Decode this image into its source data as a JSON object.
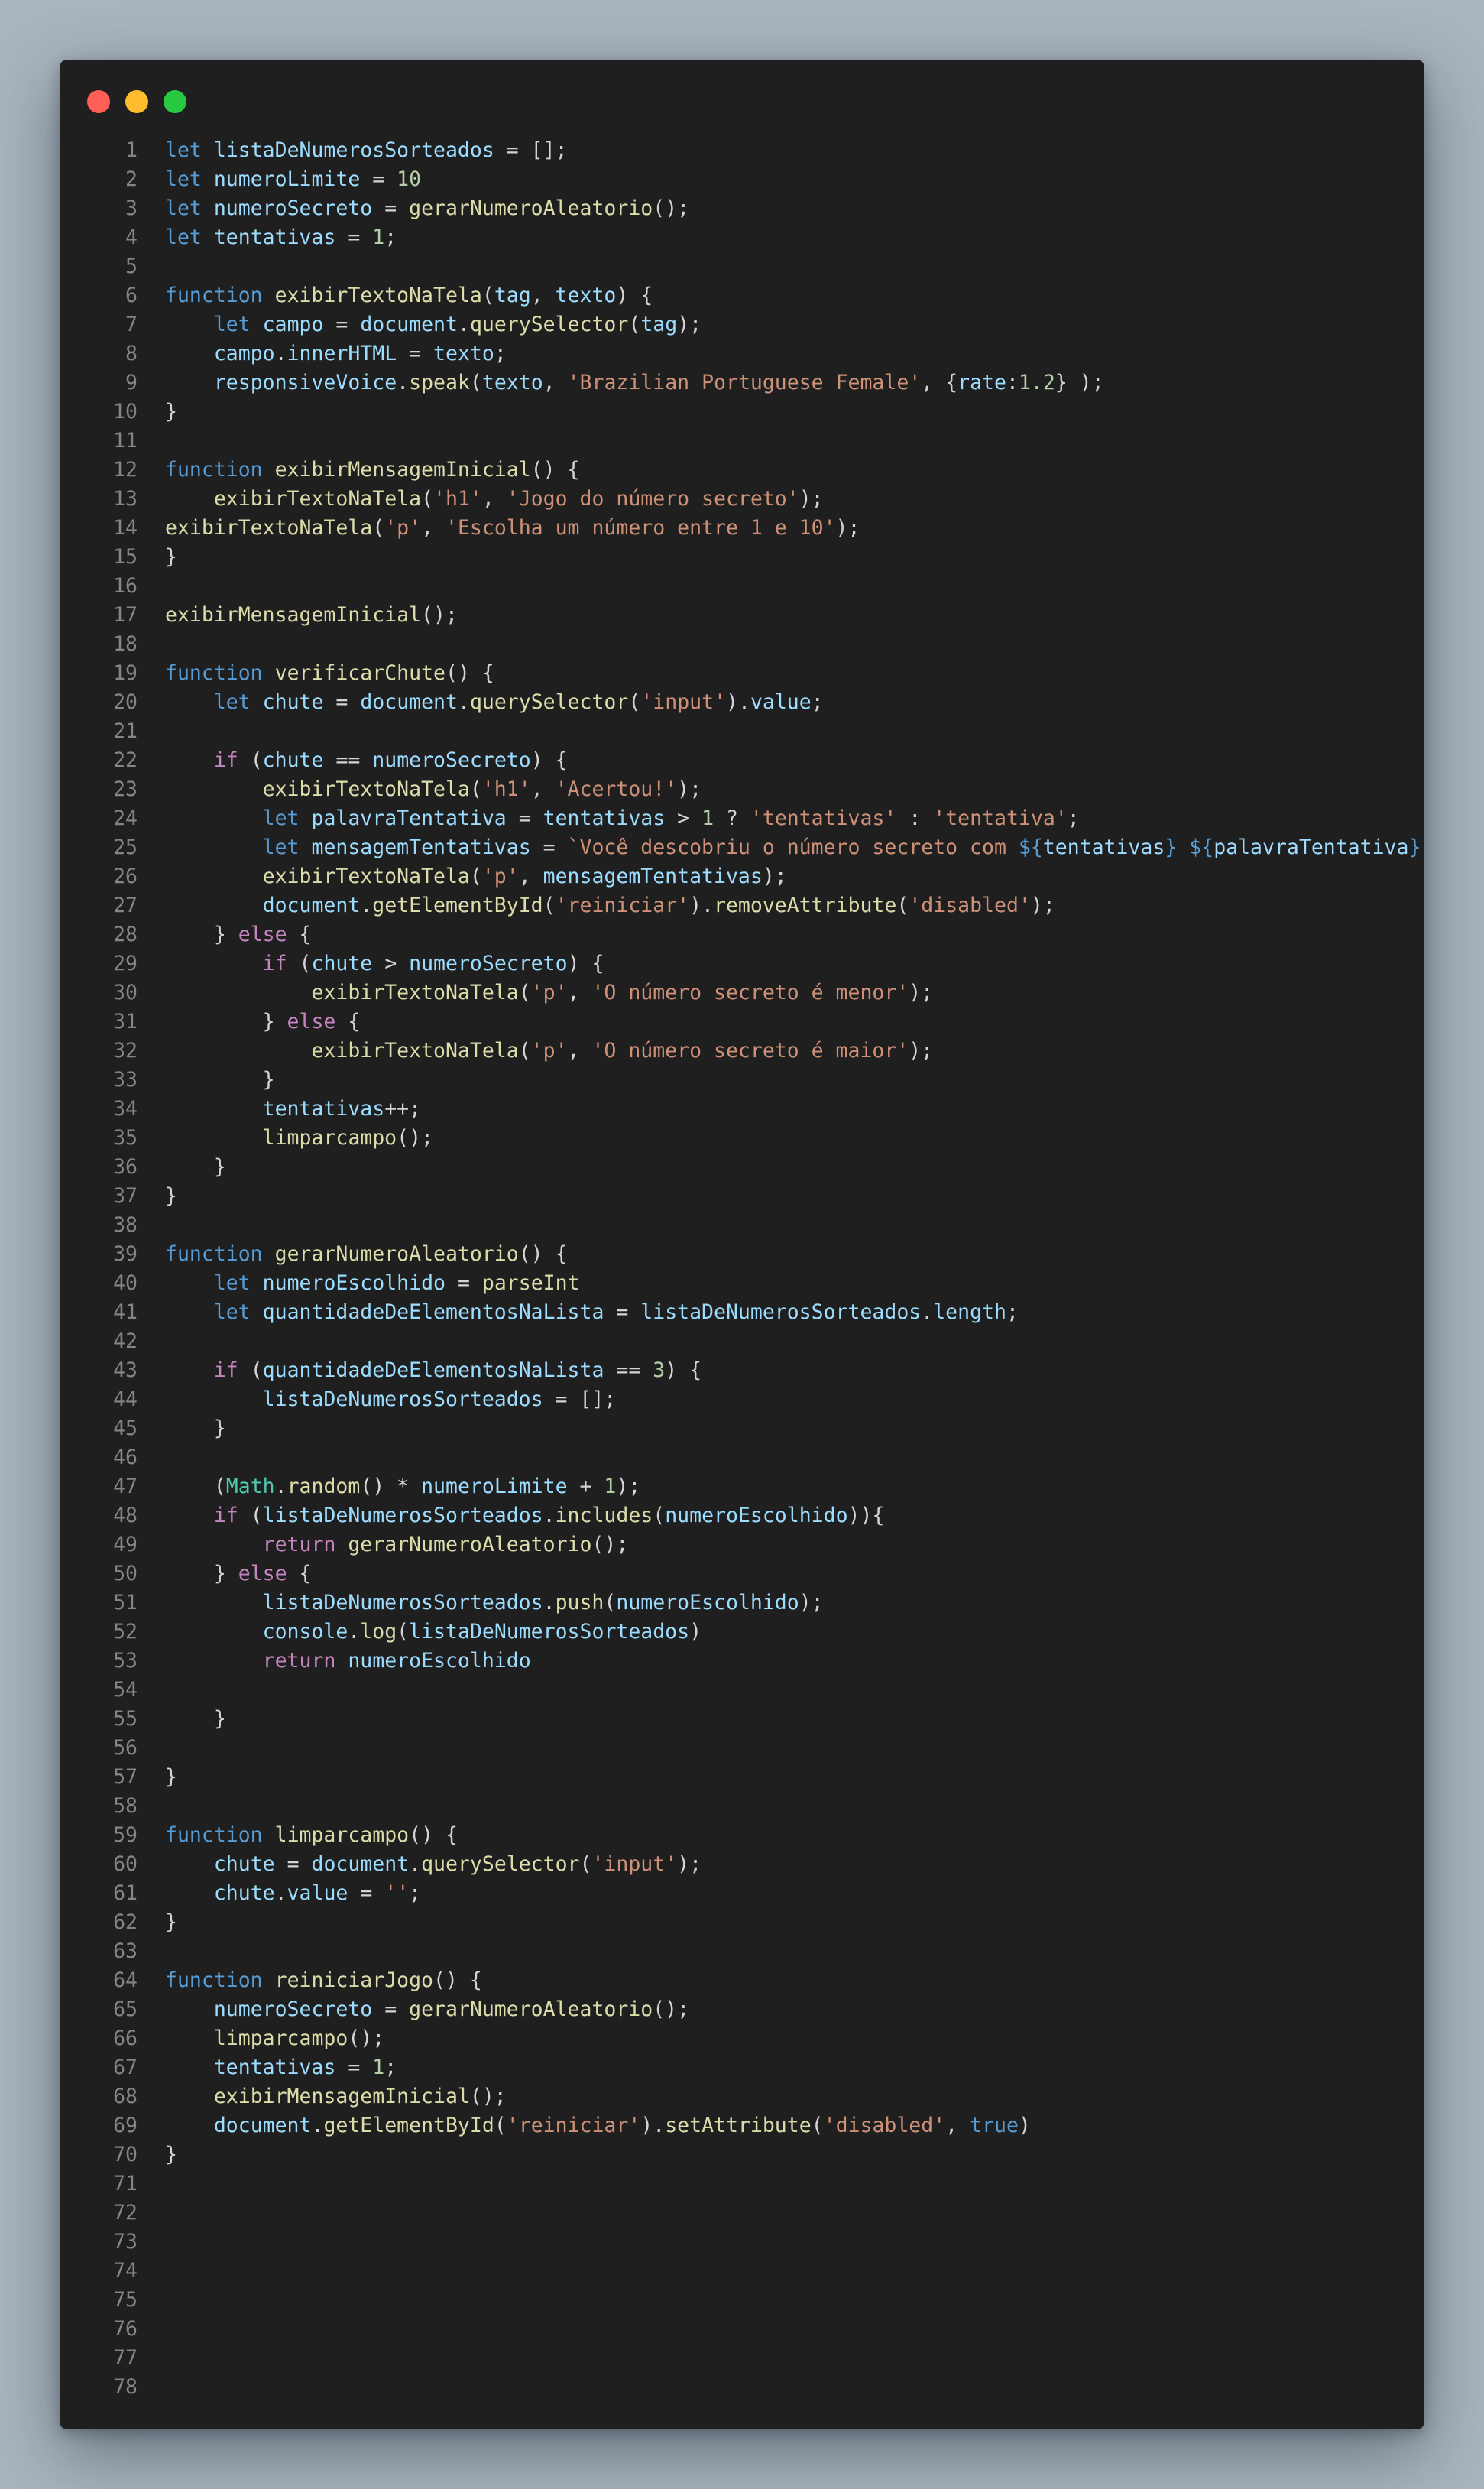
{
  "window": {
    "controls": [
      {
        "name": "close",
        "color": "#ff5f57"
      },
      {
        "name": "minimize",
        "color": "#febc2e"
      },
      {
        "name": "maximize",
        "color": "#28c840"
      }
    ]
  },
  "code": {
    "language": "javascript",
    "lines": [
      [
        [
          "k",
          "let"
        ],
        [
          "t",
          " "
        ],
        [
          "v",
          "listaDeNumerosSorteados"
        ],
        [
          "t",
          " = [];"
        ]
      ],
      [
        [
          "k",
          "let"
        ],
        [
          "t",
          " "
        ],
        [
          "v",
          "numeroLimite"
        ],
        [
          "t",
          " = "
        ],
        [
          "n",
          "10"
        ]
      ],
      [
        [
          "k",
          "let"
        ],
        [
          "t",
          " "
        ],
        [
          "v",
          "numeroSecreto"
        ],
        [
          "t",
          " = "
        ],
        [
          "f",
          "gerarNumeroAleatorio"
        ],
        [
          "t",
          "();"
        ]
      ],
      [
        [
          "k",
          "let"
        ],
        [
          "t",
          " "
        ],
        [
          "v",
          "tentativas"
        ],
        [
          "t",
          " = "
        ],
        [
          "n",
          "1"
        ],
        [
          "t",
          ";"
        ]
      ],
      [],
      [
        [
          "k",
          "function"
        ],
        [
          "t",
          " "
        ],
        [
          "f",
          "exibirTextoNaTela"
        ],
        [
          "t",
          "("
        ],
        [
          "v",
          "tag"
        ],
        [
          "t",
          ", "
        ],
        [
          "v",
          "texto"
        ],
        [
          "t",
          ") {"
        ]
      ],
      [
        [
          "t",
          "    "
        ],
        [
          "k",
          "let"
        ],
        [
          "t",
          " "
        ],
        [
          "v",
          "campo"
        ],
        [
          "t",
          " = "
        ],
        [
          "v",
          "document"
        ],
        [
          "t",
          "."
        ],
        [
          "f",
          "querySelector"
        ],
        [
          "t",
          "("
        ],
        [
          "v",
          "tag"
        ],
        [
          "t",
          ");"
        ]
      ],
      [
        [
          "t",
          "    "
        ],
        [
          "v",
          "campo"
        ],
        [
          "t",
          "."
        ],
        [
          "v",
          "innerHTML"
        ],
        [
          "t",
          " = "
        ],
        [
          "v",
          "texto"
        ],
        [
          "t",
          ";"
        ]
      ],
      [
        [
          "t",
          "    "
        ],
        [
          "v",
          "responsiveVoice"
        ],
        [
          "t",
          "."
        ],
        [
          "f",
          "speak"
        ],
        [
          "t",
          "("
        ],
        [
          "v",
          "texto"
        ],
        [
          "t",
          ", "
        ],
        [
          "s",
          "'Brazilian Portuguese Female'"
        ],
        [
          "t",
          ", {"
        ],
        [
          "v",
          "rate"
        ],
        [
          "t",
          ":"
        ],
        [
          "n",
          "1.2"
        ],
        [
          "t",
          "} );"
        ]
      ],
      [
        [
          "t",
          "}"
        ]
      ],
      [],
      [
        [
          "k",
          "function"
        ],
        [
          "t",
          " "
        ],
        [
          "f",
          "exibirMensagemInicial"
        ],
        [
          "t",
          "() {"
        ]
      ],
      [
        [
          "t",
          "    "
        ],
        [
          "f",
          "exibirTextoNaTela"
        ],
        [
          "t",
          "("
        ],
        [
          "s",
          "'h1'"
        ],
        [
          "t",
          ", "
        ],
        [
          "s",
          "'Jogo do número secreto'"
        ],
        [
          "t",
          ");"
        ]
      ],
      [
        [
          "f",
          "exibirTextoNaTela"
        ],
        [
          "t",
          "("
        ],
        [
          "s",
          "'p'"
        ],
        [
          "t",
          ", "
        ],
        [
          "s",
          "'Escolha um número entre 1 e 10'"
        ],
        [
          "t",
          ");"
        ]
      ],
      [
        [
          "t",
          "}"
        ]
      ],
      [],
      [
        [
          "f",
          "exibirMensagemInicial"
        ],
        [
          "t",
          "();"
        ]
      ],
      [],
      [
        [
          "k",
          "function"
        ],
        [
          "t",
          " "
        ],
        [
          "f",
          "verificarChute"
        ],
        [
          "t",
          "() {"
        ]
      ],
      [
        [
          "t",
          "    "
        ],
        [
          "k",
          "let"
        ],
        [
          "t",
          " "
        ],
        [
          "v",
          "chute"
        ],
        [
          "t",
          " = "
        ],
        [
          "v",
          "document"
        ],
        [
          "t",
          "."
        ],
        [
          "f",
          "querySelector"
        ],
        [
          "t",
          "("
        ],
        [
          "s",
          "'input'"
        ],
        [
          "t",
          ")."
        ],
        [
          "v",
          "value"
        ],
        [
          "t",
          ";"
        ]
      ],
      [],
      [
        [
          "t",
          "    "
        ],
        [
          "c",
          "if"
        ],
        [
          "t",
          " ("
        ],
        [
          "v",
          "chute"
        ],
        [
          "t",
          " == "
        ],
        [
          "v",
          "numeroSecreto"
        ],
        [
          "t",
          ") {"
        ]
      ],
      [
        [
          "t",
          "        "
        ],
        [
          "f",
          "exibirTextoNaTela"
        ],
        [
          "t",
          "("
        ],
        [
          "s",
          "'h1'"
        ],
        [
          "t",
          ", "
        ],
        [
          "s",
          "'Acertou!'"
        ],
        [
          "t",
          ");"
        ]
      ],
      [
        [
          "t",
          "        "
        ],
        [
          "k",
          "let"
        ],
        [
          "t",
          " "
        ],
        [
          "v",
          "palavraTentativa"
        ],
        [
          "t",
          " = "
        ],
        [
          "v",
          "tentativas"
        ],
        [
          "t",
          " > "
        ],
        [
          "n",
          "1"
        ],
        [
          "t",
          " ? "
        ],
        [
          "s",
          "'tentativas'"
        ],
        [
          "t",
          " : "
        ],
        [
          "s",
          "'tentativa'"
        ],
        [
          "t",
          ";"
        ]
      ],
      [
        [
          "t",
          "        "
        ],
        [
          "k",
          "let"
        ],
        [
          "t",
          " "
        ],
        [
          "v",
          "mensagemTentativas"
        ],
        [
          "t",
          " = "
        ],
        [
          "s",
          "`Você descobriu o número secreto com "
        ],
        [
          "k",
          "${"
        ],
        [
          "v",
          "tentativas"
        ],
        [
          "k",
          "}"
        ],
        [
          "s",
          " "
        ],
        [
          "k",
          "${"
        ],
        [
          "v",
          "palavraTentativa"
        ],
        [
          "k",
          "}"
        ],
        [
          "s",
          "!`"
        ],
        [
          "t",
          ";"
        ]
      ],
      [
        [
          "t",
          "        "
        ],
        [
          "f",
          "exibirTextoNaTela"
        ],
        [
          "t",
          "("
        ],
        [
          "s",
          "'p'"
        ],
        [
          "t",
          ", "
        ],
        [
          "v",
          "mensagemTentativas"
        ],
        [
          "t",
          ");"
        ]
      ],
      [
        [
          "t",
          "        "
        ],
        [
          "v",
          "document"
        ],
        [
          "t",
          "."
        ],
        [
          "f",
          "getElementById"
        ],
        [
          "t",
          "("
        ],
        [
          "s",
          "'reiniciar'"
        ],
        [
          "t",
          ")."
        ],
        [
          "f",
          "removeAttribute"
        ],
        [
          "t",
          "("
        ],
        [
          "s",
          "'disabled'"
        ],
        [
          "t",
          ");"
        ]
      ],
      [
        [
          "t",
          "    } "
        ],
        [
          "c",
          "else"
        ],
        [
          "t",
          " {"
        ]
      ],
      [
        [
          "t",
          "        "
        ],
        [
          "c",
          "if"
        ],
        [
          "t",
          " ("
        ],
        [
          "v",
          "chute"
        ],
        [
          "t",
          " > "
        ],
        [
          "v",
          "numeroSecreto"
        ],
        [
          "t",
          ") {"
        ]
      ],
      [
        [
          "t",
          "            "
        ],
        [
          "f",
          "exibirTextoNaTela"
        ],
        [
          "t",
          "("
        ],
        [
          "s",
          "'p'"
        ],
        [
          "t",
          ", "
        ],
        [
          "s",
          "'O número secreto é menor'"
        ],
        [
          "t",
          ");"
        ]
      ],
      [
        [
          "t",
          "        } "
        ],
        [
          "c",
          "else"
        ],
        [
          "t",
          " {"
        ]
      ],
      [
        [
          "t",
          "            "
        ],
        [
          "f",
          "exibirTextoNaTela"
        ],
        [
          "t",
          "("
        ],
        [
          "s",
          "'p'"
        ],
        [
          "t",
          ", "
        ],
        [
          "s",
          "'O número secreto é maior'"
        ],
        [
          "t",
          ");"
        ]
      ],
      [
        [
          "t",
          "        }"
        ]
      ],
      [
        [
          "t",
          "        "
        ],
        [
          "v",
          "tentativas"
        ],
        [
          "t",
          "++;"
        ]
      ],
      [
        [
          "t",
          "        "
        ],
        [
          "f",
          "limparcampo"
        ],
        [
          "t",
          "();"
        ]
      ],
      [
        [
          "t",
          "    }"
        ]
      ],
      [
        [
          "t",
          "}"
        ]
      ],
      [],
      [
        [
          "k",
          "function"
        ],
        [
          "t",
          " "
        ],
        [
          "f",
          "gerarNumeroAleatorio"
        ],
        [
          "t",
          "() {"
        ]
      ],
      [
        [
          "t",
          "    "
        ],
        [
          "k",
          "let"
        ],
        [
          "t",
          " "
        ],
        [
          "v",
          "numeroEscolhido"
        ],
        [
          "t",
          " = "
        ],
        [
          "f",
          "parseInt"
        ]
      ],
      [
        [
          "t",
          "    "
        ],
        [
          "k",
          "let"
        ],
        [
          "t",
          " "
        ],
        [
          "v",
          "quantidadeDeElementosNaLista"
        ],
        [
          "t",
          " = "
        ],
        [
          "v",
          "listaDeNumerosSorteados"
        ],
        [
          "t",
          "."
        ],
        [
          "v",
          "length"
        ],
        [
          "t",
          ";"
        ]
      ],
      [],
      [
        [
          "t",
          "    "
        ],
        [
          "c",
          "if"
        ],
        [
          "t",
          " ("
        ],
        [
          "v",
          "quantidadeDeElementosNaLista"
        ],
        [
          "t",
          " == "
        ],
        [
          "n",
          "3"
        ],
        [
          "t",
          ") {"
        ]
      ],
      [
        [
          "t",
          "        "
        ],
        [
          "v",
          "listaDeNumerosSorteados"
        ],
        [
          "t",
          " = [];"
        ]
      ],
      [
        [
          "t",
          "    }"
        ]
      ],
      [],
      [
        [
          "t",
          "    ("
        ],
        [
          "cl",
          "Math"
        ],
        [
          "t",
          "."
        ],
        [
          "f",
          "random"
        ],
        [
          "t",
          "() * "
        ],
        [
          "v",
          "numeroLimite"
        ],
        [
          "t",
          " + "
        ],
        [
          "n",
          "1"
        ],
        [
          "t",
          ");"
        ]
      ],
      [
        [
          "t",
          "    "
        ],
        [
          "c",
          "if"
        ],
        [
          "t",
          " ("
        ],
        [
          "v",
          "listaDeNumerosSorteados"
        ],
        [
          "t",
          "."
        ],
        [
          "f",
          "includes"
        ],
        [
          "t",
          "("
        ],
        [
          "v",
          "numeroEscolhido"
        ],
        [
          "t",
          ")){"
        ]
      ],
      [
        [
          "t",
          "        "
        ],
        [
          "c",
          "return"
        ],
        [
          "t",
          " "
        ],
        [
          "f",
          "gerarNumeroAleatorio"
        ],
        [
          "t",
          "();"
        ]
      ],
      [
        [
          "t",
          "    } "
        ],
        [
          "c",
          "else"
        ],
        [
          "t",
          " {"
        ]
      ],
      [
        [
          "t",
          "        "
        ],
        [
          "v",
          "listaDeNumerosSorteados"
        ],
        [
          "t",
          "."
        ],
        [
          "f",
          "push"
        ],
        [
          "t",
          "("
        ],
        [
          "v",
          "numeroEscolhido"
        ],
        [
          "t",
          ");"
        ]
      ],
      [
        [
          "t",
          "        "
        ],
        [
          "v",
          "console"
        ],
        [
          "t",
          "."
        ],
        [
          "f",
          "log"
        ],
        [
          "t",
          "("
        ],
        [
          "v",
          "listaDeNumerosSorteados"
        ],
        [
          "t",
          ")"
        ]
      ],
      [
        [
          "t",
          "        "
        ],
        [
          "c",
          "return"
        ],
        [
          "t",
          " "
        ],
        [
          "v",
          "numeroEscolhido"
        ]
      ],
      [],
      [
        [
          "t",
          "    }"
        ]
      ],
      [],
      [
        [
          "t",
          "}"
        ]
      ],
      [],
      [
        [
          "k",
          "function"
        ],
        [
          "t",
          " "
        ],
        [
          "f",
          "limparcampo"
        ],
        [
          "t",
          "() {"
        ]
      ],
      [
        [
          "t",
          "    "
        ],
        [
          "v",
          "chute"
        ],
        [
          "t",
          " = "
        ],
        [
          "v",
          "document"
        ],
        [
          "t",
          "."
        ],
        [
          "f",
          "querySelector"
        ],
        [
          "t",
          "("
        ],
        [
          "s",
          "'input'"
        ],
        [
          "t",
          ");"
        ]
      ],
      [
        [
          "t",
          "    "
        ],
        [
          "v",
          "chute"
        ],
        [
          "t",
          "."
        ],
        [
          "v",
          "value"
        ],
        [
          "t",
          " = "
        ],
        [
          "s",
          "''"
        ],
        [
          "t",
          ";"
        ]
      ],
      [
        [
          "t",
          "}"
        ]
      ],
      [],
      [
        [
          "k",
          "function"
        ],
        [
          "t",
          " "
        ],
        [
          "f",
          "reiniciarJogo"
        ],
        [
          "t",
          "() {"
        ]
      ],
      [
        [
          "t",
          "    "
        ],
        [
          "v",
          "numeroSecreto"
        ],
        [
          "t",
          " = "
        ],
        [
          "f",
          "gerarNumeroAleatorio"
        ],
        [
          "t",
          "();"
        ]
      ],
      [
        [
          "t",
          "    "
        ],
        [
          "f",
          "limparcampo"
        ],
        [
          "t",
          "();"
        ]
      ],
      [
        [
          "t",
          "    "
        ],
        [
          "v",
          "tentativas"
        ],
        [
          "t",
          " = "
        ],
        [
          "n",
          "1"
        ],
        [
          "t",
          ";"
        ]
      ],
      [
        [
          "t",
          "    "
        ],
        [
          "f",
          "exibirMensagemInicial"
        ],
        [
          "t",
          "();"
        ]
      ],
      [
        [
          "t",
          "    "
        ],
        [
          "v",
          "document"
        ],
        [
          "t",
          "."
        ],
        [
          "f",
          "getElementById"
        ],
        [
          "t",
          "("
        ],
        [
          "s",
          "'reiniciar'"
        ],
        [
          "t",
          ")."
        ],
        [
          "f",
          "setAttribute"
        ],
        [
          "t",
          "("
        ],
        [
          "s",
          "'disabled'"
        ],
        [
          "t",
          ", "
        ],
        [
          "k",
          "true"
        ],
        [
          "t",
          ")"
        ]
      ],
      [
        [
          "t",
          "}"
        ]
      ],
      [],
      [],
      [],
      [],
      [],
      [],
      [],
      []
    ]
  }
}
